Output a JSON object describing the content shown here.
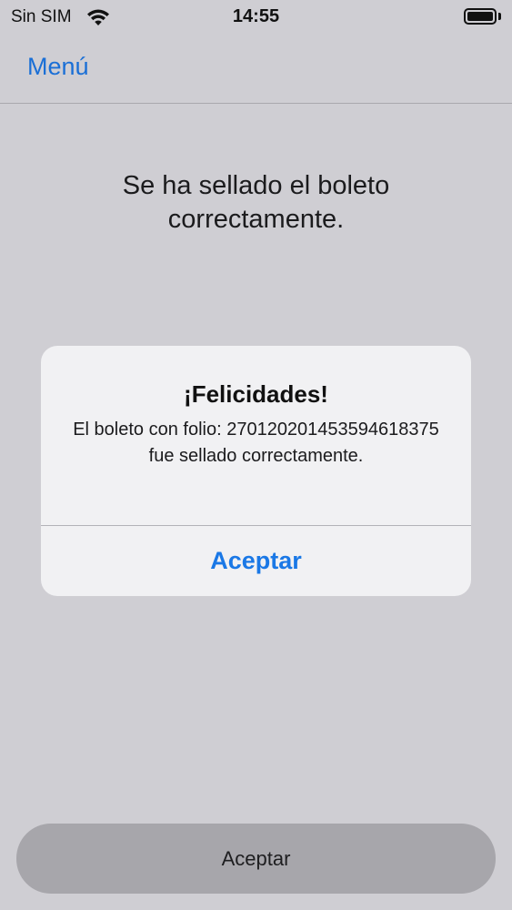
{
  "status_bar": {
    "carrier": "Sin SIM",
    "time": "14:55",
    "wifi_icon": "wifi-icon",
    "battery_icon": "battery-full-icon"
  },
  "nav": {
    "back_label": "Menú",
    "accent_color": "#1a6fd6"
  },
  "main": {
    "message": "Se ha sellado el boleto correctamente."
  },
  "alert": {
    "title": "¡Felicidades!",
    "message": "El boleto con folio: 27012020145359461837​5 fue sellado correctamente.",
    "button_label": "Aceptar",
    "button_color": "#1a78e6"
  },
  "bottom_button": {
    "label": "Aceptar"
  }
}
